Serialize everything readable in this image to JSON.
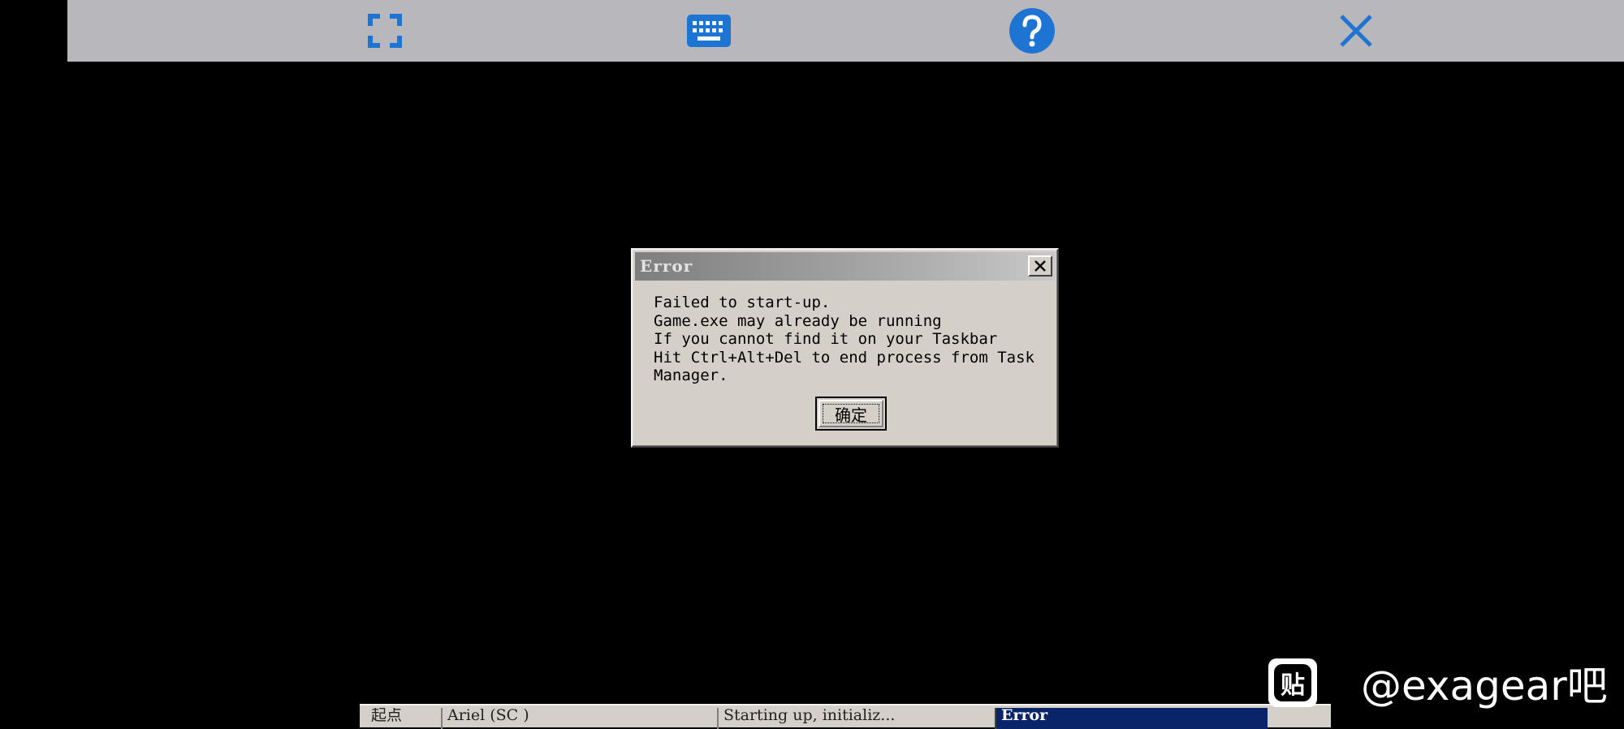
{
  "toolbar": {
    "icons": [
      "fullscreen-icon",
      "keyboard-icon",
      "help-icon",
      "close-icon"
    ],
    "accent_color": "#1e74d2",
    "background_color": "#b8b7bb"
  },
  "dialog": {
    "title": "Error",
    "lines": [
      "Failed to start-up.",
      "Game.exe may already be running",
      "If you cannot find it on your Taskbar",
      "Hit Ctrl+Alt+Del to end process from Task",
      "Manager."
    ],
    "ok_label": "确定"
  },
  "taskbar": {
    "items": [
      {
        "label": "起点"
      },
      {
        "label": "Ariel (SC )"
      },
      {
        "label": "Starting up, initializ..."
      },
      {
        "label": "Error",
        "active": true
      }
    ]
  },
  "watermark": {
    "logo_char": "贴",
    "text": "@exagear吧"
  }
}
